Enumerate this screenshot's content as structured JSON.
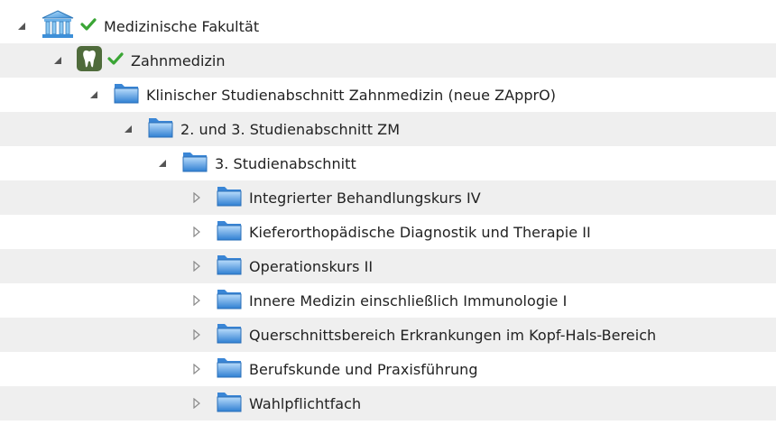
{
  "tree": {
    "nodes": [
      {
        "label": "Medizinische Fakultät",
        "icon": "university-building-icon",
        "status": "check-icon",
        "toggle": "expanded"
      },
      {
        "label": "Zahnmedizin",
        "icon": "tooth-icon",
        "status": "check-icon",
        "toggle": "expanded"
      },
      {
        "label": "Klinischer Studienabschnitt Zahnmedizin (neue ZApprO)",
        "icon": "folder-icon",
        "toggle": "expanded"
      },
      {
        "label": "2. und 3. Studienabschnitt ZM",
        "icon": "folder-icon",
        "toggle": "expanded"
      },
      {
        "label": "3. Studienabschnitt",
        "icon": "folder-icon",
        "toggle": "expanded"
      },
      {
        "label": "Integrierter Behandlungskurs IV",
        "icon": "folder-icon",
        "toggle": "collapsed"
      },
      {
        "label": "Kieferorthopädische Diagnostik und Therapie II",
        "icon": "folder-icon",
        "toggle": "collapsed"
      },
      {
        "label": "Operationskurs II",
        "icon": "folder-icon",
        "toggle": "collapsed"
      },
      {
        "label": "Innere Medizin einschließlich Immunologie I",
        "icon": "folder-icon",
        "toggle": "collapsed"
      },
      {
        "label": "Querschnittsbereich Erkrankungen im Kopf-Hals-Bereich",
        "icon": "folder-icon",
        "toggle": "collapsed"
      },
      {
        "label": "Berufskunde und Praxisführung",
        "icon": "folder-icon",
        "toggle": "collapsed"
      },
      {
        "label": "Wahlpflichtfach",
        "icon": "folder-icon",
        "toggle": "collapsed"
      }
    ]
  },
  "colors": {
    "row_shaded": "#efefef",
    "check_green": "#3aa535",
    "folder_blue": "#3f8fe0",
    "tooth_bg": "#4f6b3b",
    "toggle_gray": "#5a5a5a"
  }
}
